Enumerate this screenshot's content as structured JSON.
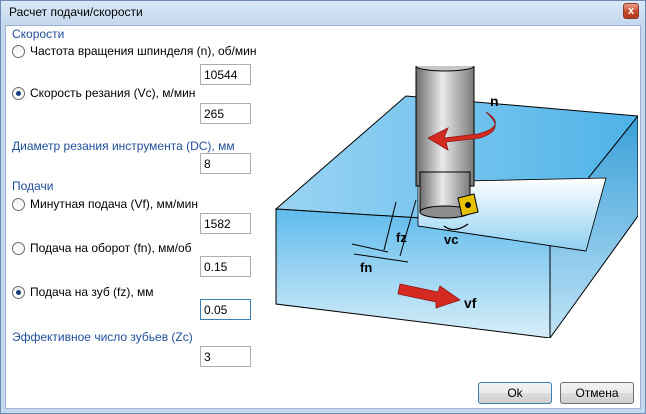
{
  "window": {
    "title": "Расчет подачи/скорости",
    "close_label": "x"
  },
  "speeds": {
    "title": "Скорости",
    "spindle_label": "Частота вращения шпинделя (n), об/мин",
    "spindle_value": "10544",
    "spindle_selected": false,
    "cutting_label": "Скорость резания (Vc), м/мин",
    "cutting_value": "265",
    "cutting_selected": true
  },
  "diameter": {
    "title": "Диаметр резания инструмента (DC), мм",
    "value": "8"
  },
  "feeds": {
    "title": "Подачи",
    "minute_label": "Минутная подача (Vf), мм/мин",
    "minute_value": "1582",
    "minute_selected": false,
    "rev_label": "Подача на оборот (fn), мм/об",
    "rev_value": "0.15",
    "rev_selected": false,
    "tooth_label": "Подача на зуб (fz), мм",
    "tooth_value": "0.05",
    "tooth_selected": true
  },
  "teeth": {
    "title": "Эффективное число зубьев (Zc)",
    "value": "3"
  },
  "illustration": {
    "label_n": "n",
    "label_vc": "vc",
    "label_fz": "fz",
    "label_fn": "fn",
    "label_vf": "vf"
  },
  "buttons": {
    "ok": "Ok",
    "cancel": "Отмена"
  },
  "colors": {
    "group_title": "#1f4e9a",
    "arrow": "#d42a22",
    "block": "#6fc3ee"
  }
}
